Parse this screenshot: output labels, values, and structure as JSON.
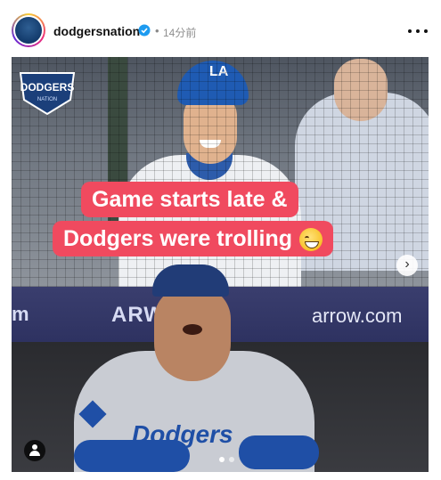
{
  "post": {
    "username": "dodgersnation",
    "verified": true,
    "separator": "•",
    "time": "14分前"
  },
  "media": {
    "team_logo_text": "DODGERS",
    "team_logo_sub": "NATION",
    "caption_line1": "Game starts late &",
    "caption_line2": "Dodgers were trolling",
    "banner_left": "m",
    "banner_logo": "ARW",
    "banner_right": "arrow.com",
    "jersey_text": "Dodgers",
    "player_logo": "LA",
    "next_arrow": "›",
    "slide_count": 2,
    "active_slide": 1
  },
  "colors": {
    "caption_bg": "#f04a5f",
    "verified": "#1d9bf0",
    "banner": "#2e3261"
  },
  "icons": [
    "verified-badge-icon",
    "more-options-icon",
    "next-arrow-icon",
    "tagged-user-icon"
  ]
}
